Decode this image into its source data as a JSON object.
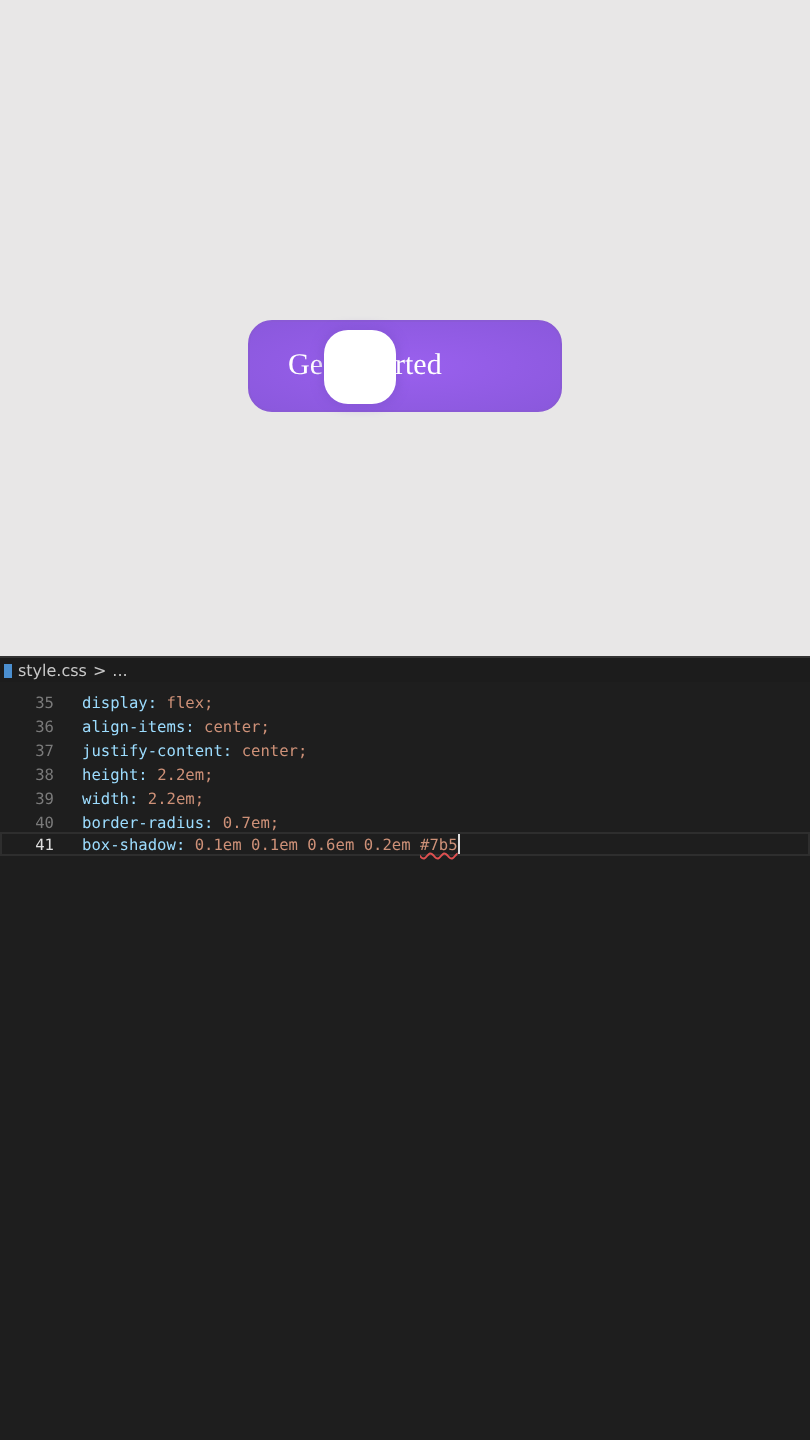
{
  "preview": {
    "button": {
      "label_before": "Ge",
      "label_after": "rted"
    }
  },
  "editor": {
    "breadcrumb": {
      "file": "style.css",
      "separator": ">",
      "rest": "..."
    },
    "lines": [
      {
        "number": "35",
        "property": "display:",
        "value": "flex;",
        "active": false
      },
      {
        "number": "36",
        "property": "align-items:",
        "value": "center;",
        "active": false
      },
      {
        "number": "37",
        "property": "justify-content:",
        "value": "center;",
        "active": false
      },
      {
        "number": "38",
        "property": "height:",
        "value": "2.2em;",
        "active": false
      },
      {
        "number": "39",
        "property": "width:",
        "value": "2.2em;",
        "active": false
      },
      {
        "number": "40",
        "property": "border-radius:",
        "value": "0.7em;",
        "active": false
      },
      {
        "number": "41",
        "property": "box-shadow:",
        "value": "0.1em 0.1em 0.6em 0.2em",
        "flagged": "#7b5",
        "active": true
      }
    ]
  }
}
